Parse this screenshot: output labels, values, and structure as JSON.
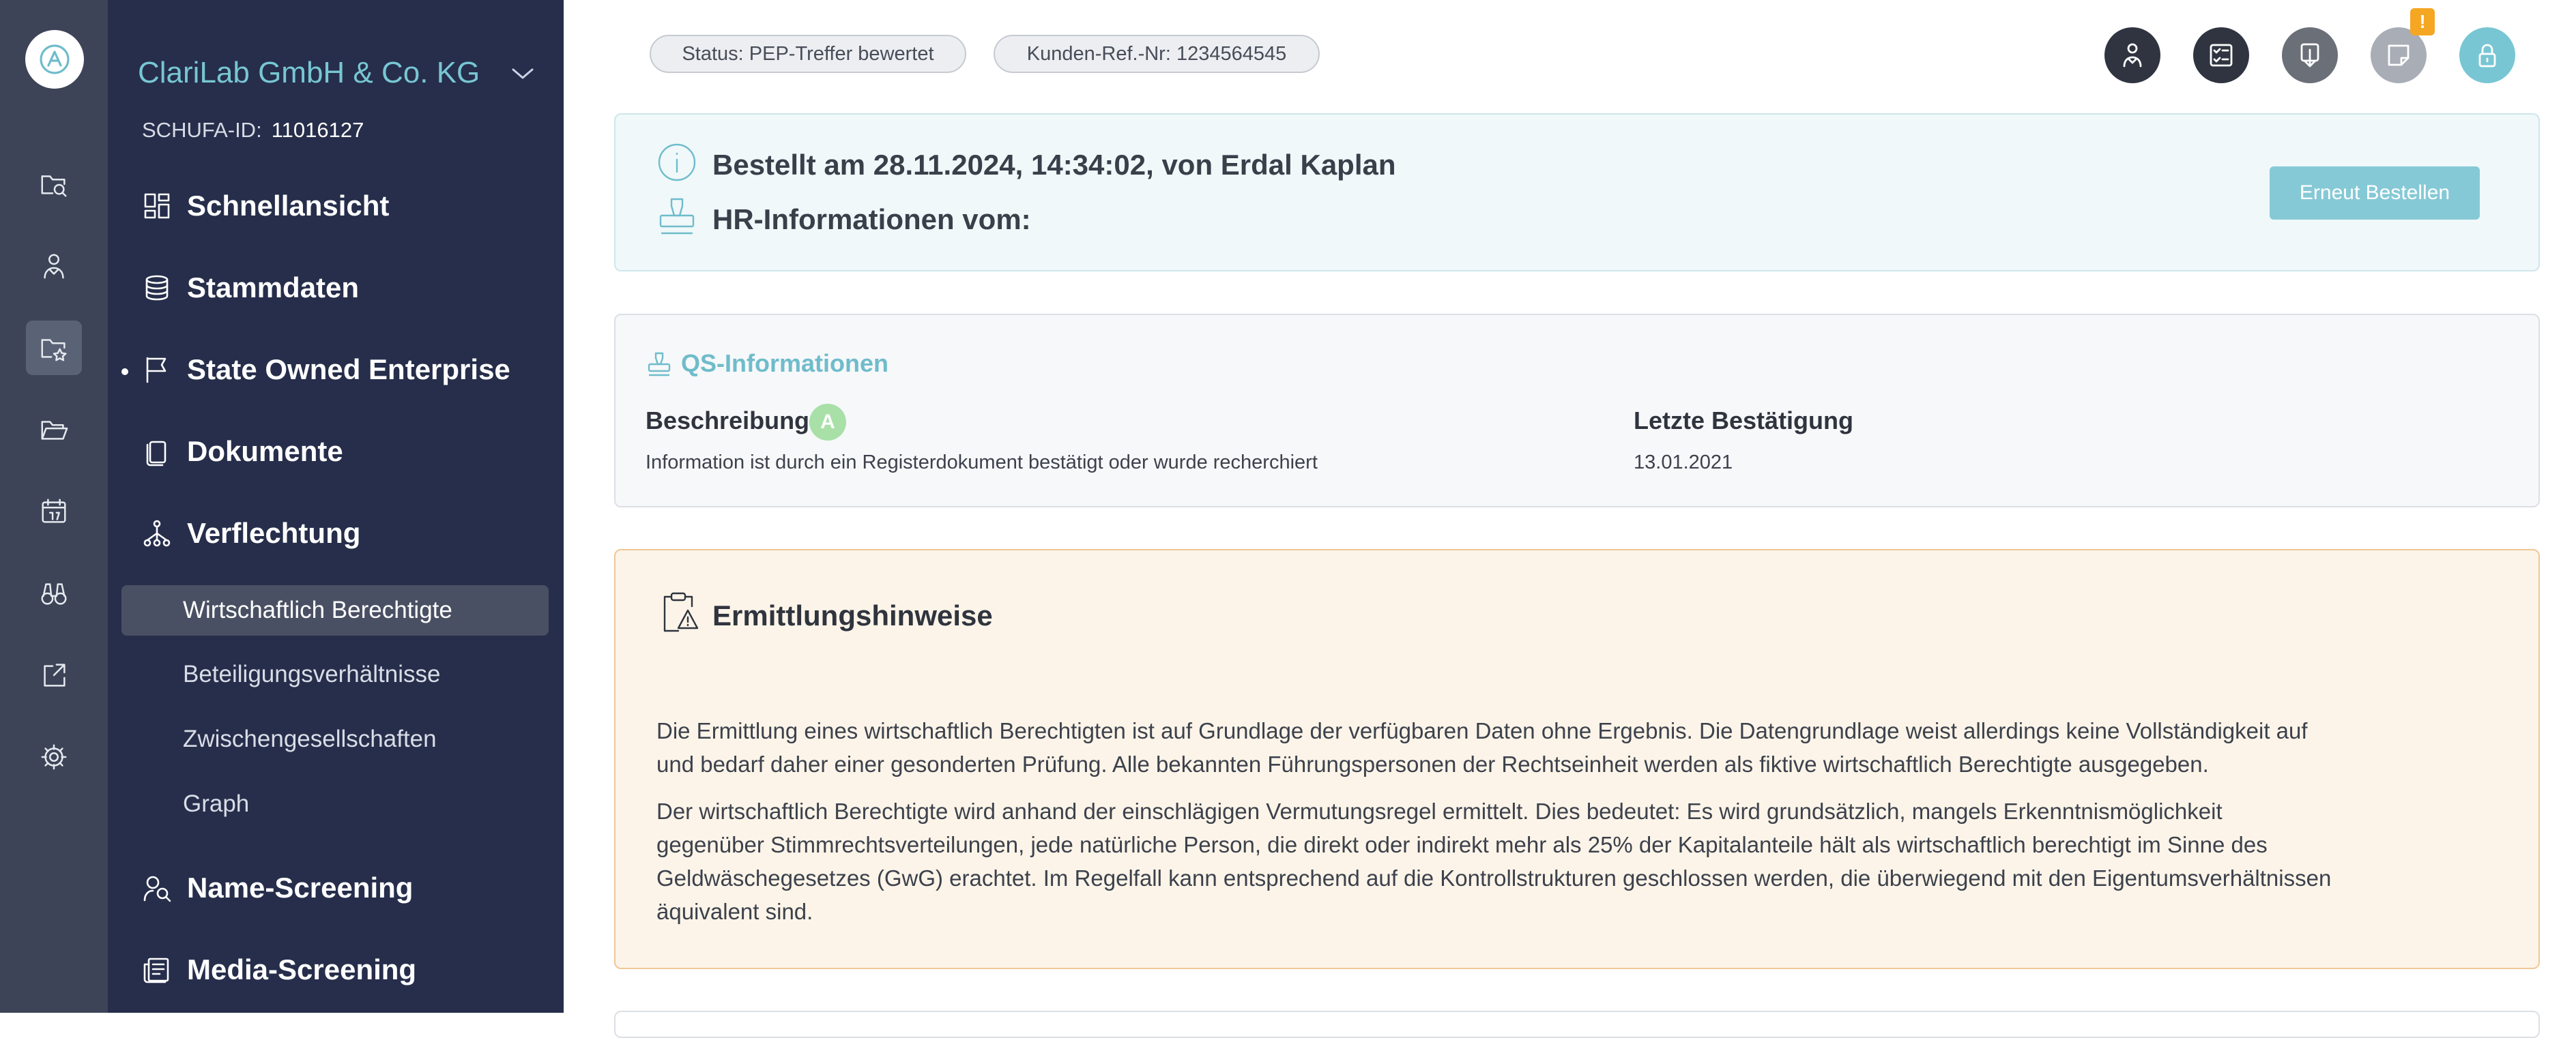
{
  "app": {
    "logo_icon": "clarilab-logo",
    "accent_color": "#6fbccb",
    "sidebar_color": "#262e4b",
    "rail_color": "#3d4457"
  },
  "rail": {
    "items": [
      {
        "icon": "folder-search-icon",
        "active": false
      },
      {
        "icon": "person-icon",
        "active": false
      },
      {
        "icon": "folder-star-icon",
        "active": true
      },
      {
        "icon": "folder-open-icon",
        "active": false
      },
      {
        "icon": "calendar-icon",
        "active": false
      },
      {
        "icon": "binoculars-icon",
        "active": false
      },
      {
        "icon": "share-box-icon",
        "active": false
      },
      {
        "icon": "settings-icon",
        "active": false
      }
    ]
  },
  "sidebar": {
    "company_name": "ClariLab GmbH & Co. KG",
    "schufa_label": "SCHUFA-ID:",
    "schufa_id": "11016127",
    "nav": [
      {
        "label": "Schnellansicht",
        "icon": "dashboard-icon"
      },
      {
        "label": "Stammdaten",
        "icon": "database-icon"
      },
      {
        "label": "State Owned Enterprise",
        "icon": "flag-icon"
      },
      {
        "label": "Dokumente",
        "icon": "documents-icon"
      },
      {
        "label": "Verflechtung",
        "icon": "network-icon"
      },
      {
        "label": "Name-Screening",
        "icon": "person-search-icon"
      },
      {
        "label": "Media-Screening",
        "icon": "newspaper-icon"
      }
    ],
    "sub_nav": [
      {
        "label": "Wirtschaftlich Berechtigte",
        "active": true
      },
      {
        "label": "Beteiligungsverhältnisse",
        "active": false
      },
      {
        "label": "Zwischengesellschaften",
        "active": false
      },
      {
        "label": "Graph",
        "active": false
      }
    ]
  },
  "header": {
    "status_pill": "Status: PEP-Treffer bewertet",
    "ref_pill": "Kunden-Ref.-Nr: 1234564545",
    "actions": [
      {
        "icon": "person-check-icon",
        "color": "#2f3440"
      },
      {
        "icon": "checklist-icon",
        "color": "#2f3440"
      },
      {
        "icon": "download-icon",
        "color": "#6b6f77"
      },
      {
        "icon": "note-icon",
        "color": "#a9adb5"
      },
      {
        "icon": "lock-icon",
        "color": "#78c6d3"
      }
    ],
    "warning_badge": "!"
  },
  "order": {
    "ordered_line": "Bestellt am 28.11.2024, 14:34:02, von Erdal Kaplan",
    "hr_line": "HR-Informationen vom:",
    "reorder_label": "Erneut Bestellen"
  },
  "qs": {
    "title": "QS-Informationen",
    "description_label": "Beschreibung",
    "grade": "A",
    "description_value": "Information ist durch ein Registerdokument bestätigt oder wurde recherchiert",
    "last_confirmation_label": "Letzte Bestätigung",
    "last_confirmation_value": "13.01.2021"
  },
  "hints": {
    "title": "Ermittlungshinweise",
    "paragraph1": "Die Ermittlung eines wirtschaftlich Berechtigten ist auf Grundlage der verfügbaren Daten ohne Ergebnis. Die Datengrundlage weist allerdings keine Vollständigkeit auf und bedarf daher einer gesonderten Prüfung. Alle bekannten Führungspersonen der Rechtseinheit werden als fiktive wirtschaftlich Berechtigte ausgegeben.",
    "paragraph2": "Der wirtschaftlich Berechtigte wird anhand der einschlägigen Vermutungsregel ermittelt. Dies bedeutet: Es wird grundsätzlich, mangels Erkenntnismöglichkeit gegenüber Stimmrechtsverteilungen, jede natürliche Person, die direkt oder indirekt mehr als 25% der Kapitalanteile hält als wirtschaftlich berechtigt im Sinne des Geldwäschegesetzes (GwG) erachtet. Im Regelfall kann entsprechend auf die Kontrollstrukturen geschlossen werden, die überwiegend mit den Eigentumsverhältnissen äquivalent sind."
  }
}
